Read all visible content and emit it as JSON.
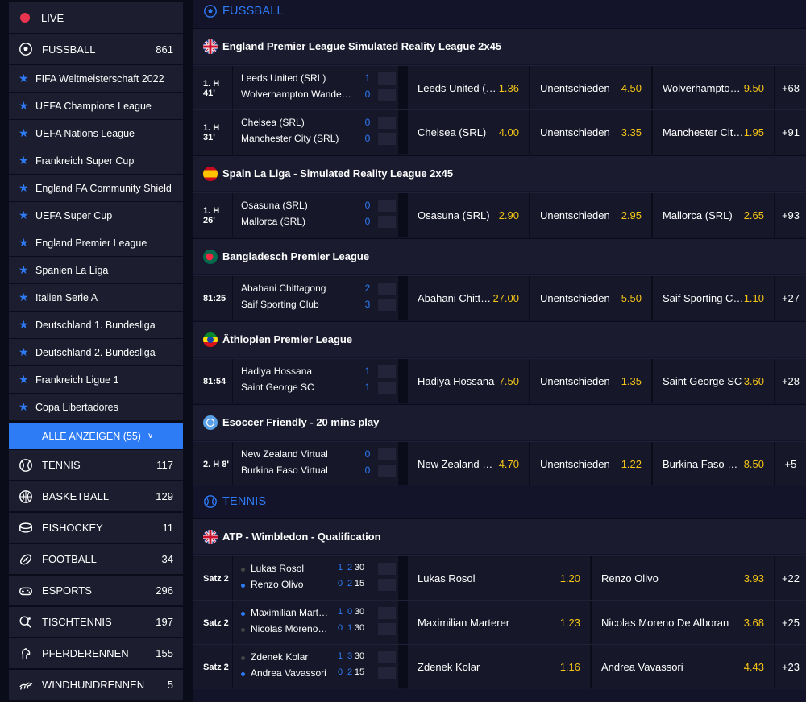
{
  "sidebar": {
    "live_label": "LIVE",
    "soccer": {
      "label": "FUSSBALL",
      "count": "861"
    },
    "leagues": [
      "FIFA Weltmeisterschaft 2022",
      "UEFA Champions League",
      "UEFA Nations League",
      "Frankreich Super Cup",
      "England FA Community Shield",
      "UEFA Super Cup",
      "England Premier League",
      "Spanien La Liga",
      "Italien Serie A",
      "Deutschland 1. Bundesliga",
      "Deutschland 2. Bundesliga",
      "Frankreich Ligue 1",
      "Copa Libertadores"
    ],
    "show_all": "ALLE ANZEIGEN (55)",
    "sports": [
      {
        "label": "TENNIS",
        "count": "117",
        "icon": "tennis-icon"
      },
      {
        "label": "BASKETBALL",
        "count": "129",
        "icon": "basketball-icon"
      },
      {
        "label": "EISHOCKEY",
        "count": "11",
        "icon": "hockey-puck-icon"
      },
      {
        "label": "FOOTBALL",
        "count": "34",
        "icon": "american-football-icon"
      },
      {
        "label": "ESPORTS",
        "count": "296",
        "icon": "gamepad-icon"
      },
      {
        "label": "TISCHTENNIS",
        "count": "197",
        "icon": "table-tennis-icon"
      },
      {
        "label": "PFERDERENNEN",
        "count": "155",
        "icon": "horse-icon"
      },
      {
        "label": "WINDHUNDRENNEN",
        "count": "5",
        "icon": "greyhound-icon"
      }
    ]
  },
  "main": {
    "soccer_header": "FUSSBALL",
    "tennis_header": "TENNIS",
    "leagues": [
      {
        "name": "England Premier League Simulated Reality League 2x45",
        "flag": "uk",
        "events": [
          {
            "time": "1. H 41'",
            "home": "Leeds United (SRL)",
            "away": "Wolverhampton Wanderers (SRL)",
            "hs": "1",
            "as": "0",
            "o1n": "Leeds United (SRL)",
            "o1": "1.36",
            "oxn": "Unentschieden",
            "ox": "4.50",
            "o2n": "Wolverhampton Wanderers (SRL)",
            "o2": "9.50",
            "more": "+68"
          },
          {
            "time": "1. H 31'",
            "home": "Chelsea (SRL)",
            "away": "Manchester City (SRL)",
            "hs": "0",
            "as": "0",
            "o1n": "Chelsea (SRL)",
            "o1": "4.00",
            "oxn": "Unentschieden",
            "ox": "3.35",
            "o2n": "Manchester City (SRL)",
            "o2": "1.95",
            "more": "+91"
          }
        ]
      },
      {
        "name": "Spain La Liga - Simulated Reality League 2x45",
        "flag": "es",
        "events": [
          {
            "time": "1. H 26'",
            "home": "Osasuna (SRL)",
            "away": "Mallorca (SRL)",
            "hs": "0",
            "as": "0",
            "o1n": "Osasuna (SRL)",
            "o1": "2.90",
            "oxn": "Unentschieden",
            "ox": "2.95",
            "o2n": "Mallorca (SRL)",
            "o2": "2.65",
            "more": "+93"
          }
        ]
      },
      {
        "name": "Bangladesch Premier League",
        "flag": "bd",
        "events": [
          {
            "time": "81:25",
            "home": "Abahani Chittagong",
            "away": "Saif Sporting Club",
            "hs": "2",
            "as": "3",
            "o1n": "Abahani Chittagong",
            "o1": "27.00",
            "oxn": "Unentschieden",
            "ox": "5.50",
            "o2n": "Saif Sporting Club",
            "o2": "1.10",
            "more": "+27"
          }
        ]
      },
      {
        "name": "Äthiopien Premier League",
        "flag": "et",
        "events": [
          {
            "time": "81:54",
            "home": "Hadiya Hossana",
            "away": "Saint George SC",
            "hs": "1",
            "as": "1",
            "o1n": "Hadiya Hossana",
            "o1": "7.50",
            "oxn": "Unentschieden",
            "ox": "1.35",
            "o2n": "Saint George SC",
            "o2": "3.60",
            "more": "+28"
          }
        ]
      },
      {
        "name": "Esoccer Friendly - 20 mins play",
        "flag": "intl",
        "events": [
          {
            "time": "2. H 8'",
            "home": "New Zealand Virtual",
            "away": "Burkina Faso Virtual",
            "hs": "0",
            "as": "0",
            "o1n": "New Zealand Virtual",
            "o1": "4.70",
            "oxn": "Unentschieden",
            "ox": "1.22",
            "o2n": "Burkina Faso Virtual",
            "o2": "8.50",
            "more": "+5"
          }
        ]
      }
    ],
    "tennis_league": {
      "name": "ATP - Wimbledon - Qualification",
      "flag": "uk",
      "events": [
        {
          "time": "Satz 2",
          "home": "Lukas Rosol",
          "away": "Renzo Olivo",
          "hs": [
            "1",
            "2",
            "30"
          ],
          "as": [
            "0",
            "2",
            "15"
          ],
          "serve": "away",
          "o1n": "Lukas Rosol",
          "o1": "1.20",
          "o2n": "Renzo Olivo",
          "o2": "3.93",
          "more": "+22"
        },
        {
          "time": "Satz 2",
          "home": "Maximilian Marterer",
          "away": "Nicolas Moreno De Alboran",
          "hs": [
            "1",
            "0",
            "30"
          ],
          "as": [
            "0",
            "1",
            "30"
          ],
          "serve": "home",
          "o1n": "Maximilian Marterer",
          "o1": "1.23",
          "o2n": "Nicolas Moreno De Alboran",
          "o2": "3.68",
          "more": "+25"
        },
        {
          "time": "Satz 2",
          "home": "Zdenek Kolar",
          "away": "Andrea Vavassori",
          "hs": [
            "1",
            "3",
            "30"
          ],
          "as": [
            "0",
            "2",
            "15"
          ],
          "serve": "away",
          "o1n": "Zdenek Kolar",
          "o1": "1.16",
          "o2n": "Andrea Vavassori",
          "o2": "4.43",
          "more": "+23"
        }
      ]
    }
  },
  "colors": {
    "accent": "#2e7bf6",
    "odds": "#f5c518",
    "live": "#e8344e"
  }
}
